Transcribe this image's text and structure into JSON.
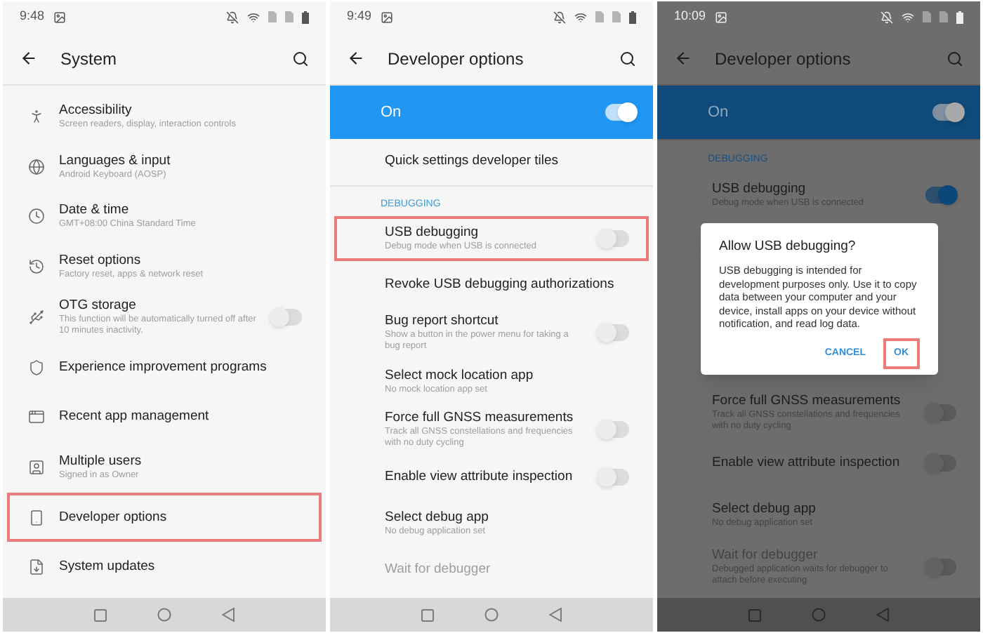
{
  "phones": [
    {
      "dimmed": false,
      "status_bar": {
        "time": "9:48"
      },
      "toolbar": {
        "title": "System"
      },
      "items": [
        {
          "kind": "row",
          "title": "Accessibility",
          "subtitle": "Screen readers, display, interaction controls",
          "highlighted": false
        },
        {
          "kind": "row",
          "title": "Languages & input",
          "subtitle": "Android Keyboard (AOSP)",
          "highlighted": false
        },
        {
          "kind": "row",
          "title": "Date & time",
          "subtitle": "GMT+08:00 China Standard Time",
          "highlighted": false
        },
        {
          "kind": "row",
          "title": "Reset options",
          "subtitle": "Factory reset, apps & network reset",
          "highlighted": false
        },
        {
          "kind": "row",
          "title": "OTG storage",
          "subtitle": "This function will be automatically turned off after 10 minutes inactivity.",
          "toggle": {
            "on": false
          },
          "highlighted": false
        },
        {
          "kind": "row",
          "title": "Experience improvement programs",
          "highlighted": false
        },
        {
          "kind": "row",
          "title": "Recent app management",
          "highlighted": false
        },
        {
          "kind": "row",
          "title": "Multiple users",
          "subtitle": "Signed in as Owner",
          "highlighted": false
        },
        {
          "kind": "row",
          "title": "Developer options",
          "highlighted": true
        },
        {
          "kind": "row",
          "title": "System updates",
          "highlighted": false
        }
      ]
    },
    {
      "dimmed": false,
      "status_bar": {
        "time": "9:49"
      },
      "toolbar": {
        "title": "Developer options"
      },
      "items": [
        {
          "kind": "master",
          "title": "On",
          "toggle": {
            "on": true
          }
        },
        {
          "kind": "row",
          "title": "Quick settings developer tiles",
          "highlighted": false,
          "disabled": false
        },
        {
          "kind": "header",
          "title": "DEBUGGING"
        },
        {
          "kind": "row",
          "title": "USB debugging",
          "subtitle": "Debug mode when USB is connected",
          "toggle": {
            "on": false
          },
          "highlighted": true,
          "disabled": false
        },
        {
          "kind": "row",
          "title": "Revoke USB debugging authorizations",
          "highlighted": false,
          "disabled": false
        },
        {
          "kind": "row",
          "title": "Bug report shortcut",
          "subtitle": "Show a button in the power menu for taking a bug report",
          "toggle": {
            "on": false
          },
          "highlighted": false,
          "disabled": false
        },
        {
          "kind": "row",
          "title": "Select mock location app",
          "subtitle": "No mock location app set",
          "highlighted": false,
          "disabled": false
        },
        {
          "kind": "row",
          "title": "Force full GNSS measurements",
          "subtitle": "Track all GNSS constellations and frequencies with no duty cycling",
          "toggle": {
            "on": false
          },
          "highlighted": false,
          "disabled": false
        },
        {
          "kind": "row",
          "title": "Enable view attribute inspection",
          "toggle": {
            "on": false
          },
          "highlighted": false,
          "disabled": false
        },
        {
          "kind": "row",
          "title": "Select debug app",
          "subtitle": "No debug application set",
          "highlighted": false,
          "disabled": false
        },
        {
          "kind": "row",
          "title": "Wait for debugger",
          "highlighted": false,
          "disabled": true
        }
      ]
    },
    {
      "dimmed": true,
      "status_bar": {
        "time": "10:09"
      },
      "toolbar": {
        "title": "Developer options"
      },
      "items": [
        {
          "kind": "master",
          "title": "On",
          "toggle": {
            "on": true
          }
        },
        {
          "kind": "header",
          "title": "DEBUGGING"
        },
        {
          "kind": "row",
          "title": "USB debugging",
          "subtitle": "Debug mode when USB is connected",
          "toggle": {
            "on": true
          },
          "highlighted": false,
          "disabled": false
        },
        {
          "kind": "covered"
        },
        {
          "kind": "row",
          "title": "Force full GNSS measurements",
          "subtitle": "Track all GNSS constellations and frequencies with no duty cycling",
          "toggle": {
            "on": false
          },
          "highlighted": false,
          "disabled": false
        },
        {
          "kind": "row",
          "title": "Enable view attribute inspection",
          "toggle": {
            "on": false
          },
          "highlighted": false,
          "disabled": false
        },
        {
          "kind": "row",
          "title": "Select debug app",
          "subtitle": "No debug application set",
          "highlighted": false,
          "disabled": false
        },
        {
          "kind": "row",
          "title": "Wait for debugger",
          "subtitle": "Debugged application waits for debugger to attach before executing",
          "toggle": {
            "on": false
          },
          "highlighted": false,
          "disabled": true
        }
      ],
      "dialog": {
        "title": "Allow USB debugging?",
        "body": "USB debugging is intended for development purposes only. Use it to copy data between your computer and your device, install apps on your device without notification, and read log data.",
        "buttons": [
          {
            "label": "CANCEL",
            "highlighted": false
          },
          {
            "label": "OK",
            "highlighted": true
          }
        ]
      }
    }
  ]
}
